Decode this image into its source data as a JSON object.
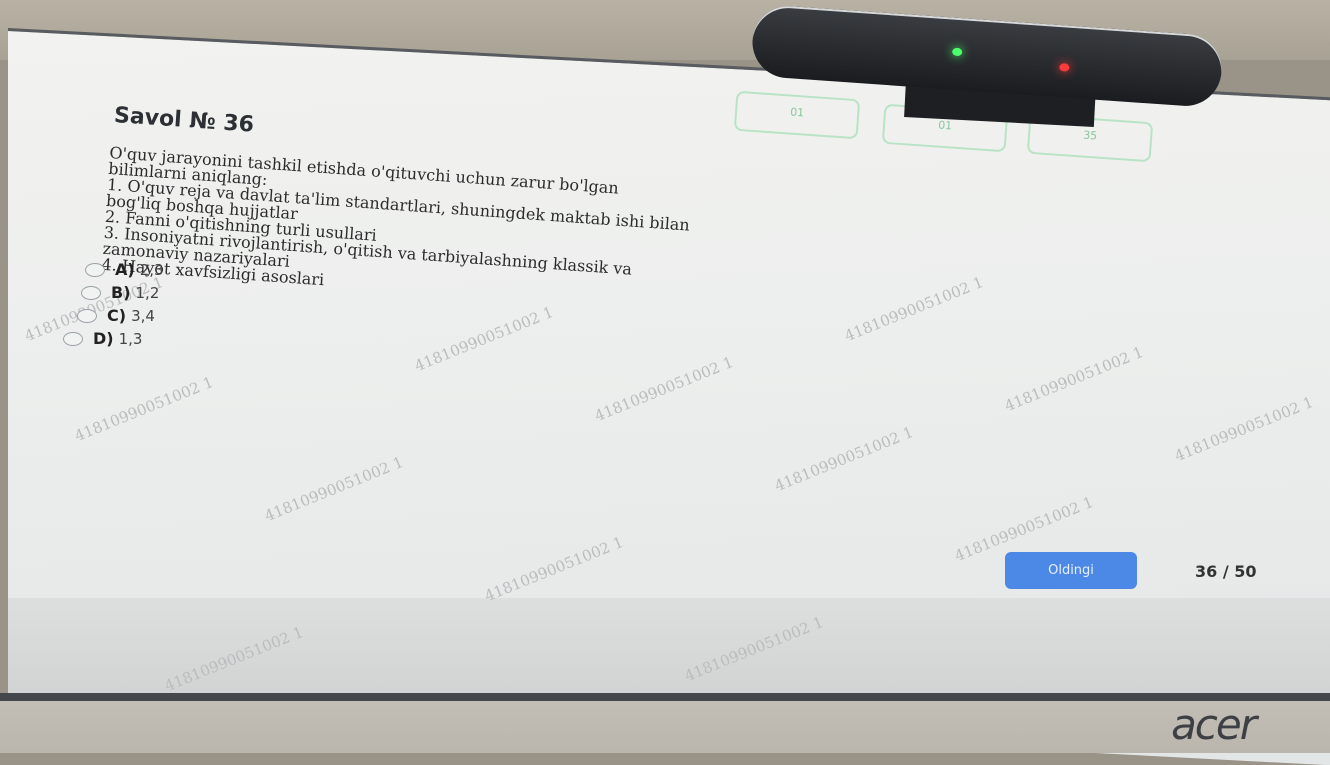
{
  "question": {
    "title": "Savol № 36",
    "lines": [
      "O'quv jarayonini tashkil etishda o'qituvchi uchun zarur bo'lgan",
      "bilimlarni aniqlang:",
      "1. O'quv reja va davlat ta'lim standartlari, shuningdek maktab ishi bilan",
      "bog'liq boshqa hujjatlar",
      "2. Fanni o'qitishning turli usullari",
      "3. Insoniyatni rivojlantirish, o'qitish va tarbiyalashning klassik va",
      "zamonaviy nazariyalari",
      "4. Hayot xavfsizligi asoslari"
    ]
  },
  "options": [
    {
      "key": "A)",
      "value": "2,3"
    },
    {
      "key": "B)",
      "value": "1,2"
    },
    {
      "key": "C)",
      "value": "3,4"
    },
    {
      "key": "D)",
      "value": "1,3"
    }
  ],
  "timer": {
    "hours": "01",
    "minutes": "01",
    "seconds": "35"
  },
  "navigation": {
    "next_label": "Oldingi",
    "counter": "36 / 50"
  },
  "watermark": "41810990051002 1",
  "brand": "acer",
  "colors": {
    "accent": "#4c88e6",
    "timer_border": "#b9e3c5"
  }
}
